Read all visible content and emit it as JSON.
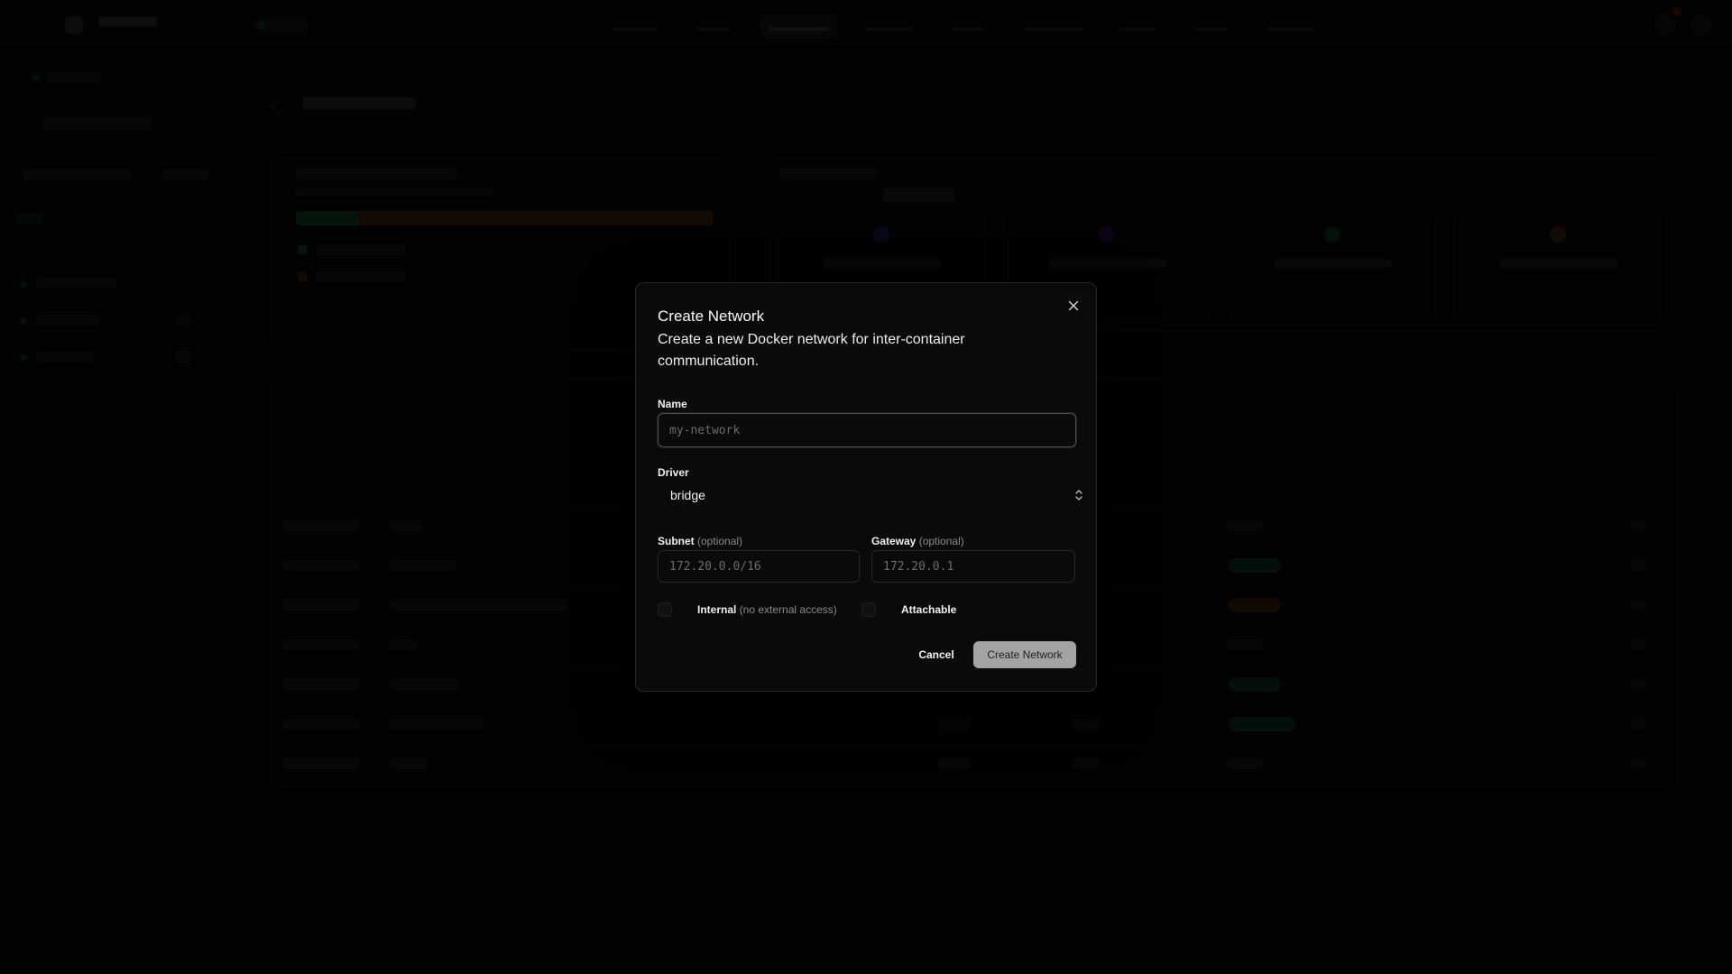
{
  "dialog": {
    "title": "Create Network",
    "description": "Create a new Docker network for inter-container communication.",
    "name_field": {
      "label": "Name",
      "placeholder": "my-network",
      "value": ""
    },
    "driver_field": {
      "label": "Driver",
      "value": "bridge"
    },
    "subnet_field": {
      "label": "Subnet",
      "optional": "(optional)",
      "placeholder": "172.20.0.0/16"
    },
    "gateway_field": {
      "label": "Gateway",
      "optional": "(optional)",
      "placeholder": "172.20.0.1"
    },
    "internal_checkbox": {
      "label": "Internal",
      "hint": "(no external access)",
      "checked": false
    },
    "attachable_checkbox": {
      "label": "Attachable",
      "checked": false
    },
    "cancel_label": "Cancel",
    "submit_label": "Create Network"
  },
  "colors": {
    "dialog_bg": "#0a0a0a",
    "dialog_border": "#262626",
    "primary_button": "#a3a3a3"
  }
}
